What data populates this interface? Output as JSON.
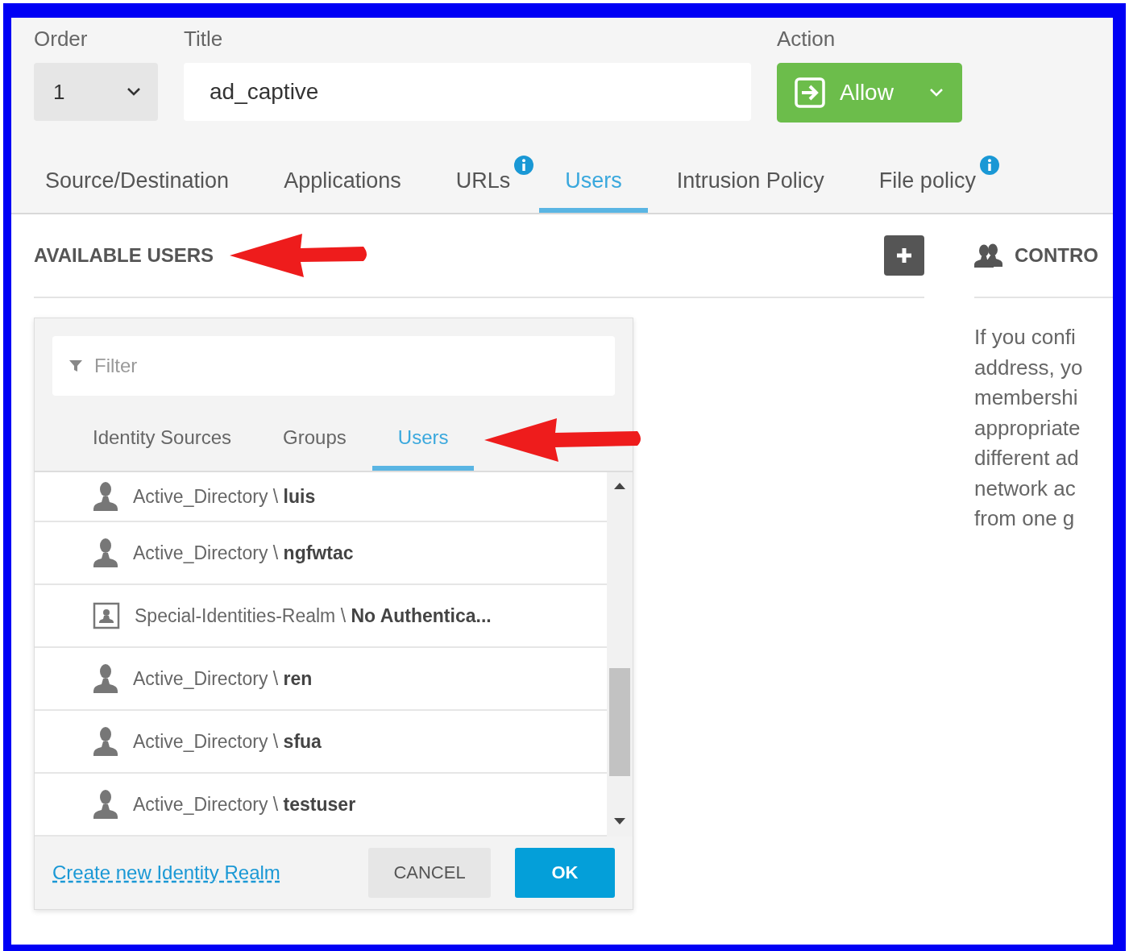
{
  "fields": {
    "order": {
      "label": "Order",
      "value": "1"
    },
    "title": {
      "label": "Title",
      "value": "ad_captive"
    },
    "action": {
      "label": "Action",
      "value": "Allow"
    }
  },
  "tabs": [
    {
      "label": "Source/Destination",
      "selected": false,
      "info": false
    },
    {
      "label": "Applications",
      "selected": false,
      "info": false
    },
    {
      "label": "URLs",
      "selected": false,
      "info": true
    },
    {
      "label": "Users",
      "selected": true,
      "info": false
    },
    {
      "label": "Intrusion Policy",
      "selected": false,
      "info": false
    },
    {
      "label": "File policy",
      "selected": false,
      "info": true
    }
  ],
  "available_users": {
    "heading": "AVAILABLE USERS"
  },
  "controlled_users": {
    "heading": "CONTRO",
    "description_lines": [
      "If you confi",
      "address, yo",
      "membershi",
      "appropriate",
      "different ad",
      "network ac",
      "from one g"
    ]
  },
  "picker": {
    "filter_placeholder": "Filter",
    "tabs": [
      {
        "label": "Identity Sources",
        "selected": false
      },
      {
        "label": "Groups",
        "selected": false
      },
      {
        "label": "Users",
        "selected": true
      }
    ],
    "items": [
      {
        "kind": "user",
        "text": "Active_Directory \\ **luis**"
      },
      {
        "kind": "user",
        "text": "Active_Directory \\ **ngfwtac**"
      },
      {
        "kind": "special",
        "text": "Special-Identities-Realm \\ **No Authentica...**"
      },
      {
        "kind": "user",
        "text": "Active_Directory \\ **ren**"
      },
      {
        "kind": "user",
        "text": "Active_Directory \\ **sfua**"
      },
      {
        "kind": "user",
        "text": "Active_Directory \\ **testuser**"
      }
    ],
    "link": "Create new Identity Realm",
    "cancel": "CANCEL",
    "ok": "OK"
  }
}
